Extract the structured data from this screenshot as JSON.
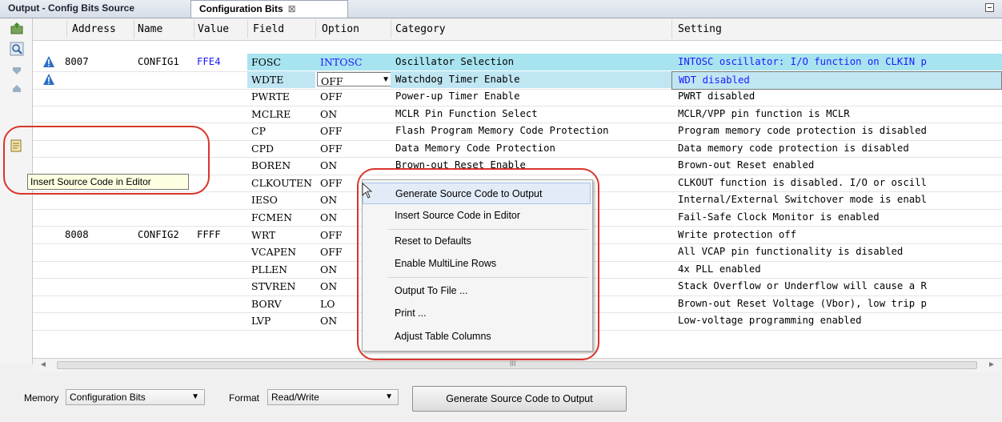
{
  "tabs": [
    {
      "label": "Output - Config Bits Source"
    },
    {
      "label": "Configuration Bits",
      "close": "⊠"
    }
  ],
  "columns": [
    "Address",
    "Name",
    "Value",
    "Field",
    "Option",
    "Category",
    "Setting"
  ],
  "rows": [
    {
      "address": "8007",
      "name": "CONFIG1",
      "value": "FFE4",
      "field": "FOSC",
      "option": "INTOSC",
      "category": "Oscillator Selection",
      "setting": "INTOSC oscillator: I/O function on CLKIN p"
    },
    {
      "address": "",
      "name": "",
      "value": "",
      "field": "WDTE",
      "option": "OFF",
      "category": "Watchdog Timer Enable",
      "setting": "WDT disabled"
    },
    {
      "address": "",
      "name": "",
      "value": "",
      "field": "PWRTE",
      "option": "OFF",
      "category": "Power-up Timer Enable",
      "setting": "PWRT disabled"
    },
    {
      "address": "",
      "name": "",
      "value": "",
      "field": "MCLRE",
      "option": "ON",
      "category": "MCLR Pin Function Select",
      "setting": "MCLR/VPP pin function is MCLR"
    },
    {
      "address": "",
      "name": "",
      "value": "",
      "field": "CP",
      "option": "OFF",
      "category": "Flash Program Memory Code Protection",
      "setting": "Program memory code protection is disabled"
    },
    {
      "address": "",
      "name": "",
      "value": "",
      "field": "CPD",
      "option": "OFF",
      "category": "Data Memory Code Protection",
      "setting": "Data memory code protection is disabled"
    },
    {
      "address": "",
      "name": "",
      "value": "",
      "field": "BOREN",
      "option": "ON",
      "category": "Brown-out Reset Enable",
      "setting": "Brown-out Reset enabled"
    },
    {
      "address": "",
      "name": "",
      "value": "",
      "field": "CLKOUTEN",
      "option": "OFF",
      "category": "",
      "setting": "CLKOUT function is disabled. I/O or oscill"
    },
    {
      "address": "",
      "name": "",
      "value": "",
      "field": "IESO",
      "option": "ON",
      "category": "er",
      "setting": "Internal/External Switchover mode is enabl"
    },
    {
      "address": "",
      "name": "",
      "value": "",
      "field": "FCMEN",
      "option": "ON",
      "category": "ble",
      "setting": "Fail-Safe Clock Monitor is enabled"
    },
    {
      "address": "8008",
      "name": "CONFIG2",
      "value": "FFFF",
      "field": "WRT",
      "option": "OFF",
      "category": "otection",
      "setting": "Write protection off"
    },
    {
      "address": "",
      "name": "",
      "value": "",
      "field": "VCAPEN",
      "option": "OFF",
      "category": "Enable",
      "setting": "All VCAP pin functionality is disabled"
    },
    {
      "address": "",
      "name": "",
      "value": "",
      "field": "PLLEN",
      "option": "ON",
      "category": "",
      "setting": "4x PLL enabled"
    },
    {
      "address": "",
      "name": "",
      "value": "",
      "field": "STVREN",
      "option": "ON",
      "category": "set Enable",
      "setting": "Stack Overflow or Underflow will cause a R"
    },
    {
      "address": "",
      "name": "",
      "value": "",
      "field": "BORV",
      "option": "LO",
      "category": "ection",
      "setting": "Brown-out Reset Voltage (Vbor), low trip p"
    },
    {
      "address": "",
      "name": "",
      "value": "",
      "field": "LVP",
      "option": "ON",
      "category": "ble",
      "setting": "Low-voltage programming enabled"
    }
  ],
  "tooltip": "Insert Source Code in Editor",
  "context_menu": [
    "Generate Source Code to Output",
    "Insert Source Code in Editor",
    "Reset to Defaults",
    "Enable MultiLine Rows",
    "Output To File ...",
    "Print ...",
    "Adjust Table Columns"
  ],
  "scrollbar_grip": "III",
  "bottom": {
    "memory_label": "Memory",
    "memory_value": "Configuration Bits",
    "format_label": "Format",
    "format_value": "Read/Write",
    "generate_button": "Generate Source Code to Output"
  },
  "colors": {
    "highlight": "#a8e4f0",
    "value_blue": "#1a1aff",
    "annotation_red": "#d8352b"
  }
}
